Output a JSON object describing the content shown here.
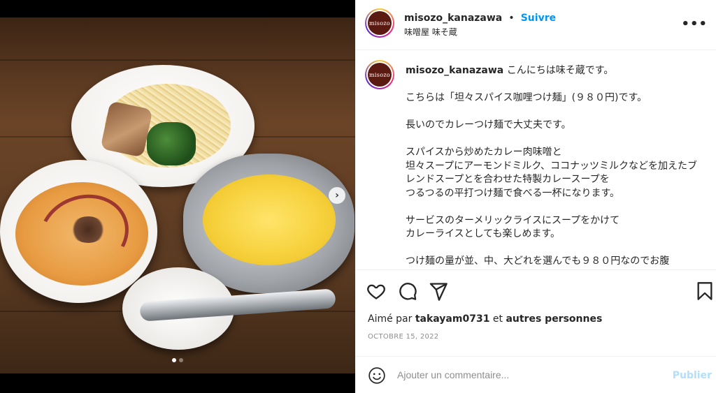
{
  "post": {
    "username": "misozo_kanazawa",
    "follow_label": "Suivre",
    "location": "味噌屋 味そ蔵",
    "avatar_text": "misozo",
    "more_label": "•••",
    "caption": "こんにちは味そ蔵です。\n\nこちらは「坦々スパイス咖哩つけ麺」(９８０円)です。\n\n長いのでカレーつけ麺で大丈夫です。\n\nスパイスから炒めたカレー肉味噌と\n坦々スープにアーモンドミルク、ココナッツミルクなどを加えたブレンドスープとを合わせた特製カレースープを\nつるつるの平打つけ麺で食べる一杯になります。\n\nサービスのターメリックライスにスープをかけて\nカレーライスとしても楽しめます。\n\nつけ麺の量が並、中、大どれを選んでも９８０円なのでお腹"
  },
  "carousel": {
    "next_label": "›",
    "dots": [
      true,
      false
    ]
  },
  "actions": {
    "like_icon": "heart-icon",
    "comment_icon": "comment-icon",
    "share_icon": "share-icon",
    "save_icon": "bookmark-icon"
  },
  "likes": {
    "prefix": "Aimé par ",
    "user": "takayam0731",
    "middle": " et ",
    "others": "autres personnes"
  },
  "date": "OCTOBRE 15, 2022",
  "comment": {
    "placeholder": "Ajouter un commentaire...",
    "publish_label": "Publier",
    "emoji_icon": "emoji-icon"
  },
  "colors": {
    "accent": "#0095f6",
    "publish_disabled": "#b2dffc",
    "text": "#262626",
    "muted": "#8e8e8e"
  }
}
